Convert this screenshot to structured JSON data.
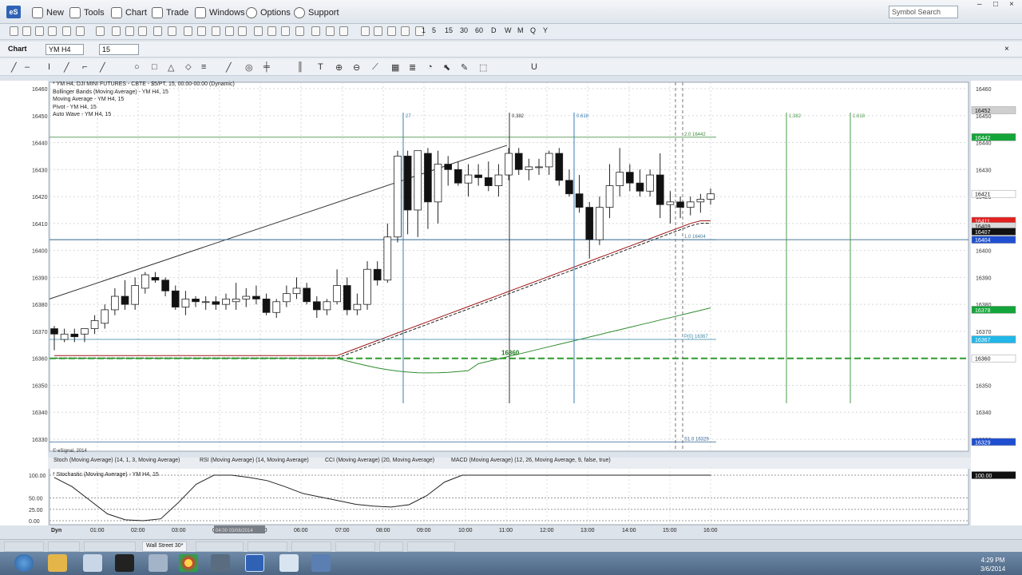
{
  "menu": {
    "new": "New",
    "tools": "Tools",
    "chart": "Chart",
    "trade": "Trade",
    "windows": "Windows",
    "options": "Options",
    "support": "Support",
    "search_placeholder": "Symbol Search"
  },
  "intervals": [
    "1",
    "5",
    "15",
    "30",
    "60",
    "D",
    "W",
    "M",
    "Q",
    "Y"
  ],
  "chart_header": {
    "label": "Chart",
    "symbol": "YM H4",
    "interval": "15"
  },
  "info_lines": [
    "* YM H4, DJI MINI FUTURES - CBTE - $5/PT, 15, 00:00-00:00 (Dynamic)",
    "Bollinger Bands (Moving Average) - YM H4, 15",
    "Moving Average - YM H4, 15",
    "Pivot - YM H4, 15",
    "Auto Wave - YM H4, 15"
  ],
  "copyright": "© eSignal, 2014",
  "indicator_tabs": [
    "Stoch (Moving Average) (14, 1, 3, Moving Average)",
    "RSI (Moving Average) (14, Moving Average)",
    "CCI (Moving Average) (20, Moving Average)",
    "MACD (Moving Average) (12, 26, Moving Average, 9, false, true)"
  ],
  "stoch_label": "* Stochastic (Moving Average) - YM H4, 15",
  "bottom_tabs": [
    "Wall Street 30*"
  ],
  "bottom_tab_active": "Wall Street 30*",
  "clock": {
    "time": "4:29 PM",
    "date": "3/6/2014"
  },
  "chart_data": {
    "type": "candlestick",
    "symbol": "YM H4",
    "ylim": [
      16325,
      16465
    ],
    "y_ticks": [
      16330,
      16340,
      16350,
      16360,
      16370,
      16380,
      16390,
      16400,
      16410,
      16420,
      16430,
      16440,
      16450,
      16460
    ],
    "x_ticks": [
      "01:00",
      "02:00",
      "03:00",
      "04:00",
      "05:00",
      "06:00",
      "07:00",
      "08:00",
      "09:00",
      "10:00",
      "11:00",
      "12:00",
      "13:00",
      "14:00",
      "15:00",
      "16:00"
    ],
    "x_axis_label": "Dyn",
    "highlight_x_label": "04:00 03/06/2014",
    "price_tags": [
      {
        "v": 16452,
        "c": "#cfcfcf",
        "t": "16452"
      },
      {
        "v": 16442,
        "c": "#13a539",
        "t": "16442"
      },
      {
        "v": 16421,
        "c": "#ffffff",
        "t": "16421"
      },
      {
        "v": 16411,
        "c": "#e32020",
        "t": "16411"
      },
      {
        "v": 16409,
        "c": "#d9d9d9",
        "t": "16409"
      },
      {
        "v": 16407,
        "c": "#111111",
        "t": "16407"
      },
      {
        "v": 16404,
        "c": "#1f4fd0",
        "t": "16404"
      },
      {
        "v": 16378,
        "c": "#13a539",
        "t": "16378"
      },
      {
        "v": 16367,
        "c": "#21b7e8",
        "t": "16367"
      },
      {
        "v": 16360,
        "c": "#ffffff",
        "t": "16360"
      },
      {
        "v": 16329,
        "c": "#1f4fd0",
        "t": "16329"
      }
    ],
    "candles": [
      {
        "o": 16371,
        "h": 16372,
        "l": 16363,
        "c": 16369
      },
      {
        "o": 16367,
        "h": 16371,
        "l": 16366,
        "c": 16369
      },
      {
        "o": 16369,
        "h": 16371,
        "l": 16366,
        "c": 16368
      },
      {
        "o": 16369,
        "h": 16371,
        "l": 16366,
        "c": 16371
      },
      {
        "o": 16371,
        "h": 16376,
        "l": 16369,
        "c": 16374
      },
      {
        "o": 16373,
        "h": 16380,
        "l": 16371,
        "c": 16378
      },
      {
        "o": 16378,
        "h": 16386,
        "l": 16376,
        "c": 16383
      },
      {
        "o": 16383,
        "h": 16389,
        "l": 16378,
        "c": 16380
      },
      {
        "o": 16380,
        "h": 16390,
        "l": 16378,
        "c": 16387
      },
      {
        "o": 16386,
        "h": 16392,
        "l": 16384,
        "c": 16391
      },
      {
        "o": 16390,
        "h": 16392,
        "l": 16388,
        "c": 16389
      },
      {
        "o": 16389,
        "h": 16390,
        "l": 16383,
        "c": 16385
      },
      {
        "o": 16385,
        "h": 16387,
        "l": 16378,
        "c": 16379
      },
      {
        "o": 16379,
        "h": 16385,
        "l": 16376,
        "c": 16382
      },
      {
        "o": 16382,
        "h": 16383,
        "l": 16379,
        "c": 16381
      },
      {
        "o": 16381,
        "h": 16383,
        "l": 16378,
        "c": 16381
      },
      {
        "o": 16381,
        "h": 16383,
        "l": 16378,
        "c": 16380
      },
      {
        "o": 16380,
        "h": 16384,
        "l": 16378,
        "c": 16382
      },
      {
        "o": 16381,
        "h": 16388,
        "l": 16378,
        "c": 16382
      },
      {
        "o": 16382,
        "h": 16386,
        "l": 16379,
        "c": 16383
      },
      {
        "o": 16383,
        "h": 16387,
        "l": 16380,
        "c": 16382
      },
      {
        "o": 16382,
        "h": 16384,
        "l": 16376,
        "c": 16377
      },
      {
        "o": 16377,
        "h": 16382,
        "l": 16375,
        "c": 16381
      },
      {
        "o": 16381,
        "h": 16387,
        "l": 16379,
        "c": 16384
      },
      {
        "o": 16384,
        "h": 16390,
        "l": 16382,
        "c": 16386
      },
      {
        "o": 16386,
        "h": 16388,
        "l": 16380,
        "c": 16381
      },
      {
        "o": 16381,
        "h": 16383,
        "l": 16375,
        "c": 16378
      },
      {
        "o": 16378,
        "h": 16382,
        "l": 16376,
        "c": 16381
      },
      {
        "o": 16381,
        "h": 16393,
        "l": 16380,
        "c": 16387
      },
      {
        "o": 16387,
        "h": 16390,
        "l": 16376,
        "c": 16378
      },
      {
        "o": 16378,
        "h": 16384,
        "l": 16376,
        "c": 16380
      },
      {
        "o": 16380,
        "h": 16396,
        "l": 16378,
        "c": 16393
      },
      {
        "o": 16393,
        "h": 16396,
        "l": 16387,
        "c": 16389
      },
      {
        "o": 16389,
        "h": 16410,
        "l": 16388,
        "c": 16405
      },
      {
        "o": 16405,
        "h": 16437,
        "l": 16403,
        "c": 16435
      },
      {
        "o": 16435,
        "h": 16437,
        "l": 16406,
        "c": 16415
      },
      {
        "o": 16415,
        "h": 16437,
        "l": 16405,
        "c": 16437
      },
      {
        "o": 16436,
        "h": 16438,
        "l": 16408,
        "c": 16418
      },
      {
        "o": 16418,
        "h": 16437,
        "l": 16410,
        "c": 16432
      },
      {
        "o": 16432,
        "h": 16435,
        "l": 16424,
        "c": 16430
      },
      {
        "o": 16430,
        "h": 16433,
        "l": 16424,
        "c": 16425
      },
      {
        "o": 16425,
        "h": 16432,
        "l": 16420,
        "c": 16428
      },
      {
        "o": 16428,
        "h": 16432,
        "l": 16424,
        "c": 16427
      },
      {
        "o": 16427,
        "h": 16433,
        "l": 16422,
        "c": 16424
      },
      {
        "o": 16424,
        "h": 16432,
        "l": 16420,
        "c": 16428
      },
      {
        "o": 16428,
        "h": 16438,
        "l": 16426,
        "c": 16436
      },
      {
        "o": 16436,
        "h": 16438,
        "l": 16428,
        "c": 16430
      },
      {
        "o": 16430,
        "h": 16434,
        "l": 16426,
        "c": 16431
      },
      {
        "o": 16431,
        "h": 16434,
        "l": 16428,
        "c": 16431
      },
      {
        "o": 16431,
        "h": 16437,
        "l": 16428,
        "c": 16436
      },
      {
        "o": 16436,
        "h": 16438,
        "l": 16424,
        "c": 16426
      },
      {
        "o": 16426,
        "h": 16430,
        "l": 16420,
        "c": 16421
      },
      {
        "o": 16421,
        "h": 16428,
        "l": 16414,
        "c": 16416
      },
      {
        "o": 16416,
        "h": 16418,
        "l": 16397,
        "c": 16404
      },
      {
        "o": 16404,
        "h": 16420,
        "l": 16402,
        "c": 16416
      },
      {
        "o": 16416,
        "h": 16432,
        "l": 16412,
        "c": 16424
      },
      {
        "o": 16424,
        "h": 16438,
        "l": 16420,
        "c": 16429
      },
      {
        "o": 16429,
        "h": 16432,
        "l": 16422,
        "c": 16425
      },
      {
        "o": 16425,
        "h": 16430,
        "l": 16420,
        "c": 16422
      },
      {
        "o": 16422,
        "h": 16430,
        "l": 16420,
        "c": 16428
      },
      {
        "o": 16428,
        "h": 16436,
        "l": 16412,
        "c": 16417
      },
      {
        "o": 16417,
        "h": 16422,
        "l": 16410,
        "c": 16418
      },
      {
        "o": 16418,
        "h": 16420,
        "l": 16412,
        "c": 16416
      },
      {
        "o": 16416,
        "h": 16420,
        "l": 16413,
        "c": 16418
      },
      {
        "o": 16418,
        "h": 16421,
        "l": 16414,
        "c": 16419
      },
      {
        "o": 16419,
        "h": 16423,
        "l": 16417,
        "c": 16421
      }
    ],
    "fib_lines": [
      {
        "v": 16442,
        "label": "2.0 16442",
        "color": "#3b8a3b"
      },
      {
        "v": 16404,
        "label": "1.0 16404",
        "color": "#4a7a9a"
      },
      {
        "v": 16367,
        "label": "P(0) 16367",
        "color": "#3b8aa8"
      },
      {
        "v": 16329,
        "label": "S1.0 16329",
        "color": "#3b6a9a"
      }
    ],
    "pivot_value": 16360,
    "pivot_label": "16360",
    "time_lines": [
      {
        "label": "27",
        "color": "#3a7fb0"
      },
      {
        "label": "0.382",
        "color": "#333333"
      },
      {
        "label": "0.618",
        "color": "#3a7fb0"
      },
      {
        "label": "1.382",
        "color": "#4a9a4a"
      },
      {
        "label": "1.618",
        "color": "#4a9a4a"
      }
    ],
    "stoch_ticks": [
      "100.00",
      "50.00",
      "25.00",
      "0.00"
    ],
    "stoch_tag": "100.00"
  }
}
